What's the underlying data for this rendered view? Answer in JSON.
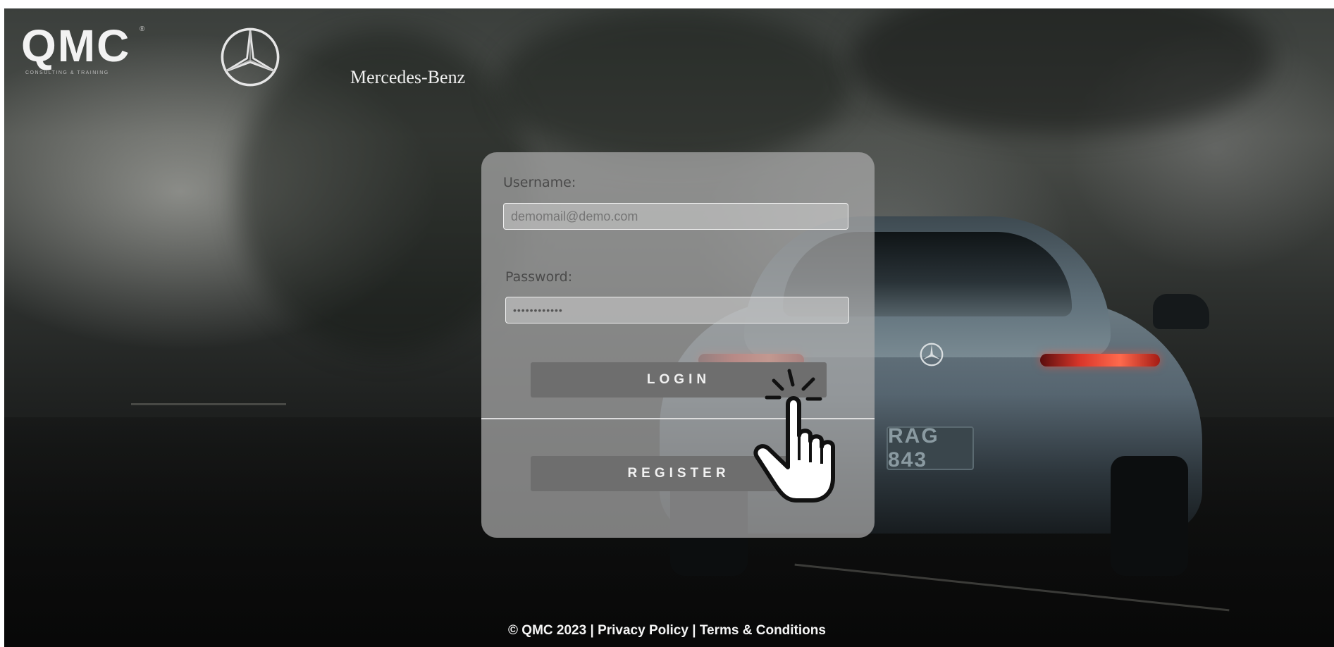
{
  "brand": {
    "qmc_logo": "QMC",
    "qmc_registered": "®",
    "qmc_tagline": "CONSULTING & TRAINING",
    "partner_name": "Mercedes-Benz"
  },
  "background": {
    "license_plate": "RAG 843"
  },
  "login_form": {
    "username_label": "Username:",
    "username_placeholder": "demomail@demo.com",
    "password_label": "Password:",
    "password_value": "••••••••••••",
    "login_button": "LOGIN",
    "register_button": "REGISTER"
  },
  "footer": {
    "copyright": "© QMC 2023",
    "separator": "|",
    "privacy_link": "Privacy Policy",
    "terms_link": "Terms & Conditions"
  },
  "icons": {
    "cursor": "pointing-hand-click-icon",
    "partner_logo": "three-pointed-star-icon"
  },
  "colors": {
    "card_bg": "#aaaaaa",
    "button_bg": "#6e6e6e",
    "button_text": "#f1f1f1"
  }
}
